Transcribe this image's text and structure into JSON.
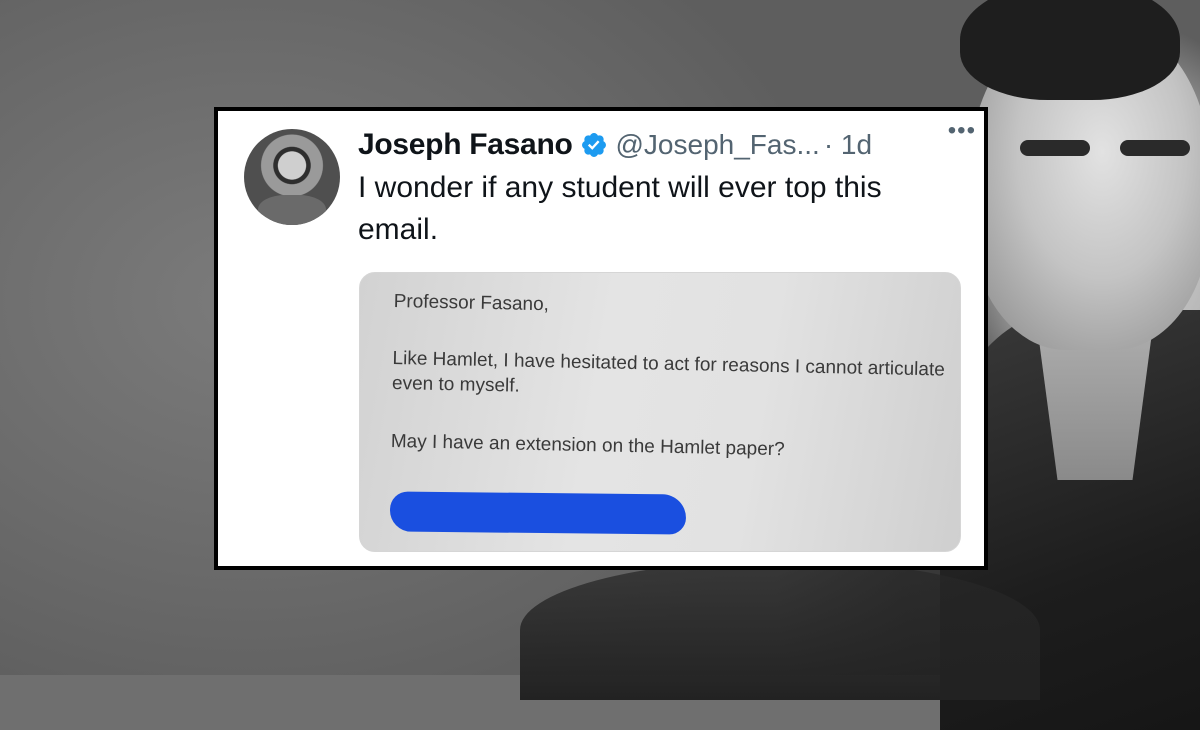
{
  "tweet": {
    "author_name": "Joseph Fasano",
    "handle": "@Joseph_Fas...",
    "time": "· 1d",
    "more_label": "•••",
    "text": "I wonder if any student will ever top this email.",
    "verified_icon": "verified-badge-icon"
  },
  "email_image": {
    "greeting": "Professor Fasano,",
    "paragraph1": "Like Hamlet, I have hesitated to act for reasons I cannot articulate even to myself.",
    "paragraph2": "May I have an extension on the Hamlet paper?",
    "redaction_mark": "\""
  },
  "colors": {
    "verified_blue": "#1d9bf0",
    "redaction_blue": "#1a4fe0",
    "text_primary": "#0f1419",
    "text_secondary": "#536471"
  }
}
